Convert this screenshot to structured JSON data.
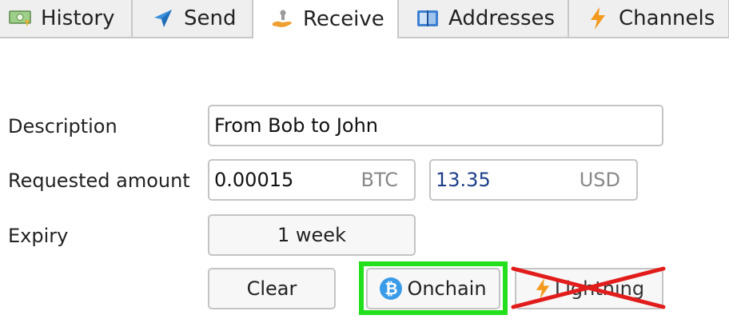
{
  "tabs": [
    {
      "label": "History",
      "icon": "history-icon"
    },
    {
      "label": "Send",
      "icon": "send-icon"
    },
    {
      "label": "Receive",
      "icon": "receive-icon",
      "active": true
    },
    {
      "label": "Addresses",
      "icon": "addresses-icon"
    },
    {
      "label": "Channels",
      "icon": "channels-icon"
    }
  ],
  "form": {
    "description_label": "Description",
    "description_value": "From Bob to John",
    "amount_label": "Requested amount",
    "amount_btc": "0.00015",
    "btc_unit": "BTC",
    "amount_fiat": "13.35",
    "fiat_unit": "USD",
    "expiry_label": "Expiry",
    "expiry_value": "1 week"
  },
  "buttons": {
    "clear": "Clear",
    "onchain": "Onchain",
    "onchain_icon": "bitcoin-icon",
    "lightning": "Lightning",
    "lightning_icon": "lightning-icon",
    "lightning_disabled_mark": "crossed-out"
  },
  "colors": {
    "highlight": "#22e01c",
    "cross": "#e21b1b",
    "fiat_text": "#1d3f8a",
    "bitcoin_icon": "#3a9be8",
    "lightning_icon": "#f39a1d"
  }
}
